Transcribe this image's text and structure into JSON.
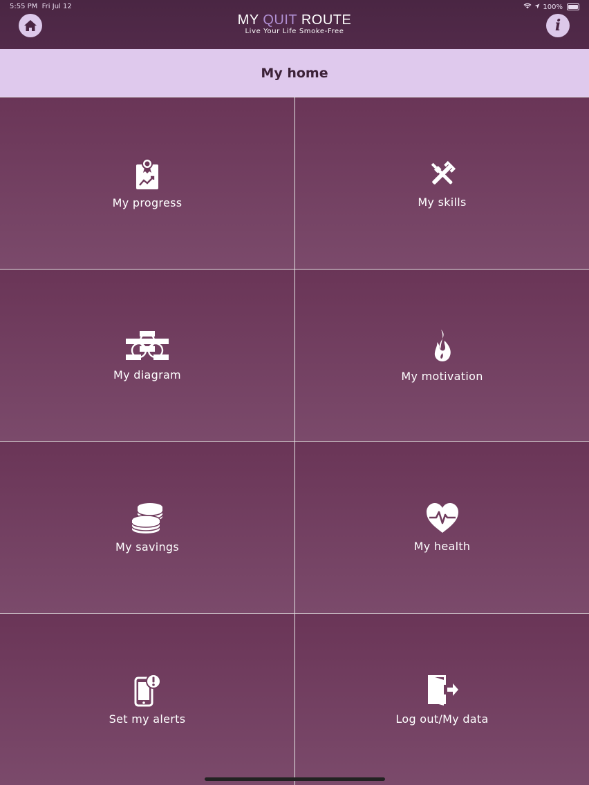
{
  "status_bar": {
    "time": "5:55 PM",
    "date": "Fri Jul 12",
    "battery": "100%"
  },
  "header": {
    "title_part1": "MY ",
    "title_part2": "QUIT",
    "title_part3": " ROUTE",
    "subtitle": "Live Your Life Smoke-Free",
    "info_glyph": "i"
  },
  "page": {
    "title": "My home"
  },
  "tiles": [
    {
      "label": "My progress",
      "icon": "progress-report-icon"
    },
    {
      "label": "My skills",
      "icon": "tools-icon"
    },
    {
      "label": "My diagram",
      "icon": "diagram-icon"
    },
    {
      "label": "My motivation",
      "icon": "flame-icon"
    },
    {
      "label": "My savings",
      "icon": "coins-icon"
    },
    {
      "label": "My health",
      "icon": "heart-pulse-icon"
    },
    {
      "label": "Set my alerts",
      "icon": "phone-alert-icon"
    },
    {
      "label": "Log out/My data",
      "icon": "exit-door-icon"
    }
  ],
  "colors": {
    "header": "#4a2643",
    "accent": "#b08fd2",
    "titlebar": "#dfc9ed",
    "tile": "#6f3c5d"
  }
}
